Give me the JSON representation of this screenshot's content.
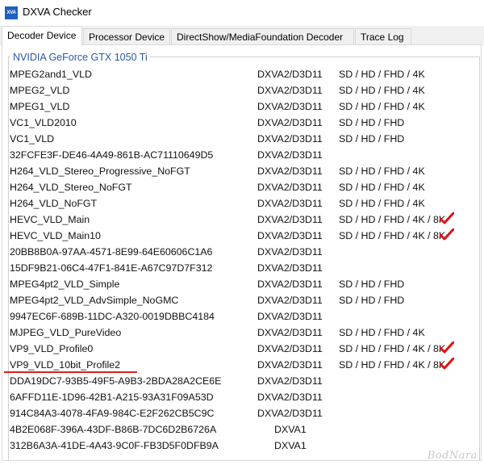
{
  "window": {
    "icon_text": "XVA",
    "title": "DXVA Checker"
  },
  "tabs": [
    {
      "label": "Decoder Device",
      "active": true
    },
    {
      "label": "Processor Device",
      "active": false
    },
    {
      "label": "DirectShow/MediaFoundation Decoder",
      "active": false
    },
    {
      "label": "Trace Log",
      "active": false
    }
  ],
  "group": {
    "label": "NVIDIA GeForce GTX 1050 Ti"
  },
  "decoders": [
    {
      "name": "MPEG2and1_VLD",
      "api": "DXVA2/D3D11",
      "resolutions": "SD / HD / FHD / 4K",
      "checked": false
    },
    {
      "name": "MPEG2_VLD",
      "api": "DXVA2/D3D11",
      "resolutions": "SD / HD / FHD / 4K",
      "checked": false
    },
    {
      "name": "MPEG1_VLD",
      "api": "DXVA2/D3D11",
      "resolutions": "SD / HD / FHD / 4K",
      "checked": false
    },
    {
      "name": "VC1_VLD2010",
      "api": "DXVA2/D3D11",
      "resolutions": "SD / HD / FHD",
      "checked": false
    },
    {
      "name": "VC1_VLD",
      "api": "DXVA2/D3D11",
      "resolutions": "SD / HD / FHD",
      "checked": false
    },
    {
      "name": "32FCFE3F-DE46-4A49-861B-AC71110649D5",
      "api": "DXVA2/D3D11",
      "resolutions": "",
      "checked": false
    },
    {
      "name": "H264_VLD_Stereo_Progressive_NoFGT",
      "api": "DXVA2/D3D11",
      "resolutions": "SD / HD / FHD / 4K",
      "checked": false
    },
    {
      "name": "H264_VLD_Stereo_NoFGT",
      "api": "DXVA2/D3D11",
      "resolutions": "SD / HD / FHD / 4K",
      "checked": false
    },
    {
      "name": "H264_VLD_NoFGT",
      "api": "DXVA2/D3D11",
      "resolutions": "SD / HD / FHD / 4K",
      "checked": false
    },
    {
      "name": "HEVC_VLD_Main",
      "api": "DXVA2/D3D11",
      "resolutions": "SD / HD / FHD / 4K / 8K",
      "checked": true
    },
    {
      "name": "HEVC_VLD_Main10",
      "api": "DXVA2/D3D11",
      "resolutions": "SD / HD / FHD / 4K / 8K",
      "checked": true
    },
    {
      "name": "20BB8B0A-97AA-4571-8E99-64E60606C1A6",
      "api": "DXVA2/D3D11",
      "resolutions": "",
      "checked": false
    },
    {
      "name": "15DF9B21-06C4-47F1-841E-A67C97D7F312",
      "api": "DXVA2/D3D11",
      "resolutions": "",
      "checked": false
    },
    {
      "name": "MPEG4pt2_VLD_Simple",
      "api": "DXVA2/D3D11",
      "resolutions": "SD / HD / FHD",
      "checked": false
    },
    {
      "name": "MPEG4pt2_VLD_AdvSimple_NoGMC",
      "api": "DXVA2/D3D11",
      "resolutions": "SD / HD / FHD",
      "checked": false
    },
    {
      "name": "9947EC6F-689B-11DC-A320-0019DBBC4184",
      "api": "DXVA2/D3D11",
      "resolutions": "",
      "checked": false
    },
    {
      "name": "MJPEG_VLD_PureVideo",
      "api": "DXVA2/D3D11",
      "resolutions": "SD / HD / FHD / 4K",
      "checked": false
    },
    {
      "name": "VP9_VLD_Profile0",
      "api": "DXVA2/D3D11",
      "resolutions": "SD / HD / FHD / 4K / 8K",
      "checked": true
    },
    {
      "name": "VP9_VLD_10bit_Profile2",
      "api": "DXVA2/D3D11",
      "resolutions": "SD / HD / FHD / 4K / 8K",
      "checked": true,
      "underlined": true
    },
    {
      "name": "DDA19DC7-93B5-49F5-A9B3-2BDA28A2CE6E",
      "api": "DXVA2/D3D11",
      "resolutions": "",
      "checked": false
    },
    {
      "name": "6AFFD11E-1D96-42B1-A215-93A31F09A53D",
      "api": "DXVA2/D3D11",
      "resolutions": "",
      "checked": false
    },
    {
      "name": "914C84A3-4078-4FA9-984C-E2F262CB5C9C",
      "api": "DXVA2/D3D11",
      "resolutions": "",
      "checked": false
    },
    {
      "name": "4B2E068F-396A-43DF-B86B-7DC6D2B6726A",
      "api": "DXVA1",
      "resolutions": "",
      "checked": false
    },
    {
      "name": "312B6A3A-41DE-4A43-9C0F-FB3D5F0DFB9A",
      "api": "DXVA1",
      "resolutions": "",
      "checked": false
    }
  ],
  "watermark": "BodNara",
  "colors": {
    "group_label": "#2a58a8",
    "checkmark": "#e01010",
    "underline": "#d92020"
  }
}
